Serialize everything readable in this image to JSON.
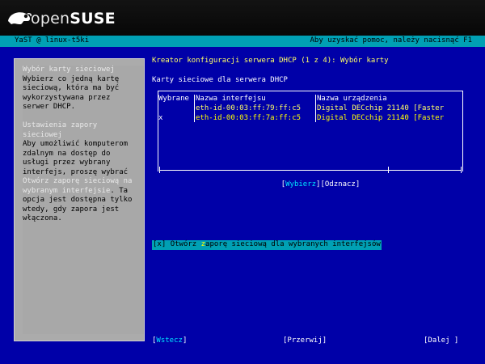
{
  "branding": {
    "logo_open": "open",
    "logo_suse": "SUSE",
    "logo_icon": "gecko-icon"
  },
  "titlebar": {
    "left": "YaST @ linux-t5ki",
    "right": "Aby uzyskać pomoc, należy nacisnąć F1"
  },
  "help": {
    "section1_title": [
      "Wybór karty sieciowej"
    ],
    "section1_body": [
      "Wybierz co jedną kartę",
      "sieciową, która ma być",
      "wykorzystywana przez",
      "serwer DHCP."
    ],
    "section2_title": [
      "Ustawienia zapory",
      "sieciowej"
    ],
    "section2_body_a": [
      "Aby umożliwić komputerom",
      "zdalnym na dostęp do",
      "usługi przez wybrany",
      "interfejs, proszę wybrać"
    ],
    "section2_highlight": [
      "Otwórz zaporę sieciową na",
      "wybranym interfejsie"
    ],
    "section2_body_b_tail": ". Ta",
    "section2_body_c": [
      "opcja jest dostępna tylko",
      "wtedy, gdy zapora jest",
      "włączona."
    ]
  },
  "main": {
    "title": "Kreator konfiguracji serwera DHCP (1 z 4): Wybór karty",
    "cards_label": "Karty sieciowe dla serwera DHCP"
  },
  "table": {
    "columns": [
      "Wybrane",
      "Nazwa interfejsu",
      "Nazwa urządzenia"
    ],
    "rows": [
      {
        "selected": "",
        "interface": "eth-id-00:03:ff:79:ff:c5",
        "device": "Digital DECchip 21140 [Faster"
      },
      {
        "selected": "x",
        "interface": "eth-id-00:03:ff:7a:ff:c5",
        "device": "Digital DECchip 21140 [Faster"
      }
    ]
  },
  "buttons": {
    "select": "Wybierz",
    "deselect": "Odznacz",
    "back": "Wstecz",
    "abort": "Przerwij",
    "next": "Dalej"
  },
  "firewall": {
    "checkbox": "[x]",
    "label_pre": "Otwórz ",
    "label_hot": "z",
    "label_post": "aporę sieciową dla wybranych interfejsów"
  },
  "colors": {
    "background": "#0000a8",
    "titlebar": "#00a0b4",
    "accent_yellow": "#ffff66",
    "help_bg": "#a8a8a8",
    "button_text": "#00e4ff"
  }
}
